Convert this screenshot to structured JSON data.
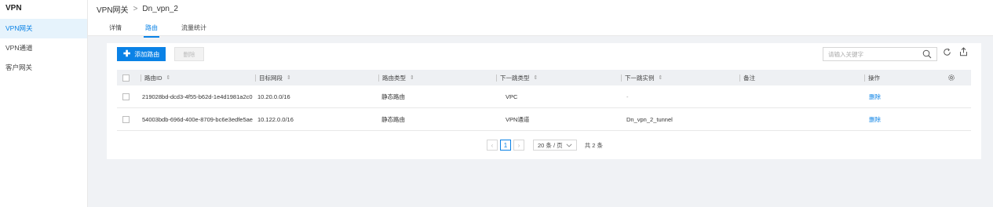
{
  "sidebar": {
    "title": "VPN",
    "items": [
      {
        "label": "VPN网关"
      },
      {
        "label": "VPN通道"
      },
      {
        "label": "客户网关"
      }
    ]
  },
  "breadcrumb": {
    "parent": "VPN网关",
    "separator": ">",
    "current": "Dn_vpn_2"
  },
  "tabs": [
    {
      "label": "详情"
    },
    {
      "label": "路由"
    },
    {
      "label": "流量统计"
    }
  ],
  "toolbar": {
    "add_label": "添加路由",
    "delete_label": "删除"
  },
  "search": {
    "placeholder": "请输入关键字",
    "value": ""
  },
  "table": {
    "headers": {
      "route_id": "路由ID",
      "cidr": "目标网段",
      "route_type": "路由类型",
      "next_hop_type": "下一跳类型",
      "next_hop_instance": "下一跳实例",
      "note": "备注",
      "operation": "操作"
    },
    "rows": [
      {
        "route_id": "219028bd-dcd3-4f55-b62d-1e4d1981a2c0",
        "cidr": "10.20.0.0/16",
        "route_type": "静态路由",
        "next_hop_type": "VPC",
        "next_hop_instance": "-",
        "note": "",
        "operation": "删除"
      },
      {
        "route_id": "54003bdb-696d-400e-8709-bc6e3edfe5ae",
        "cidr": "10.122.0.0/16",
        "route_type": "静态路由",
        "next_hop_type": "VPN通道",
        "next_hop_instance": "Dn_vpn_2_tunnel",
        "note": "",
        "operation": "删除"
      }
    ]
  },
  "pagination": {
    "current_page": "1",
    "page_size": "20 条 / 页",
    "total": "共 2 条"
  },
  "colors": {
    "accent": "#0a82e6",
    "header_bg": "#eef0f3",
    "page_bg": "#f0f2f5"
  }
}
